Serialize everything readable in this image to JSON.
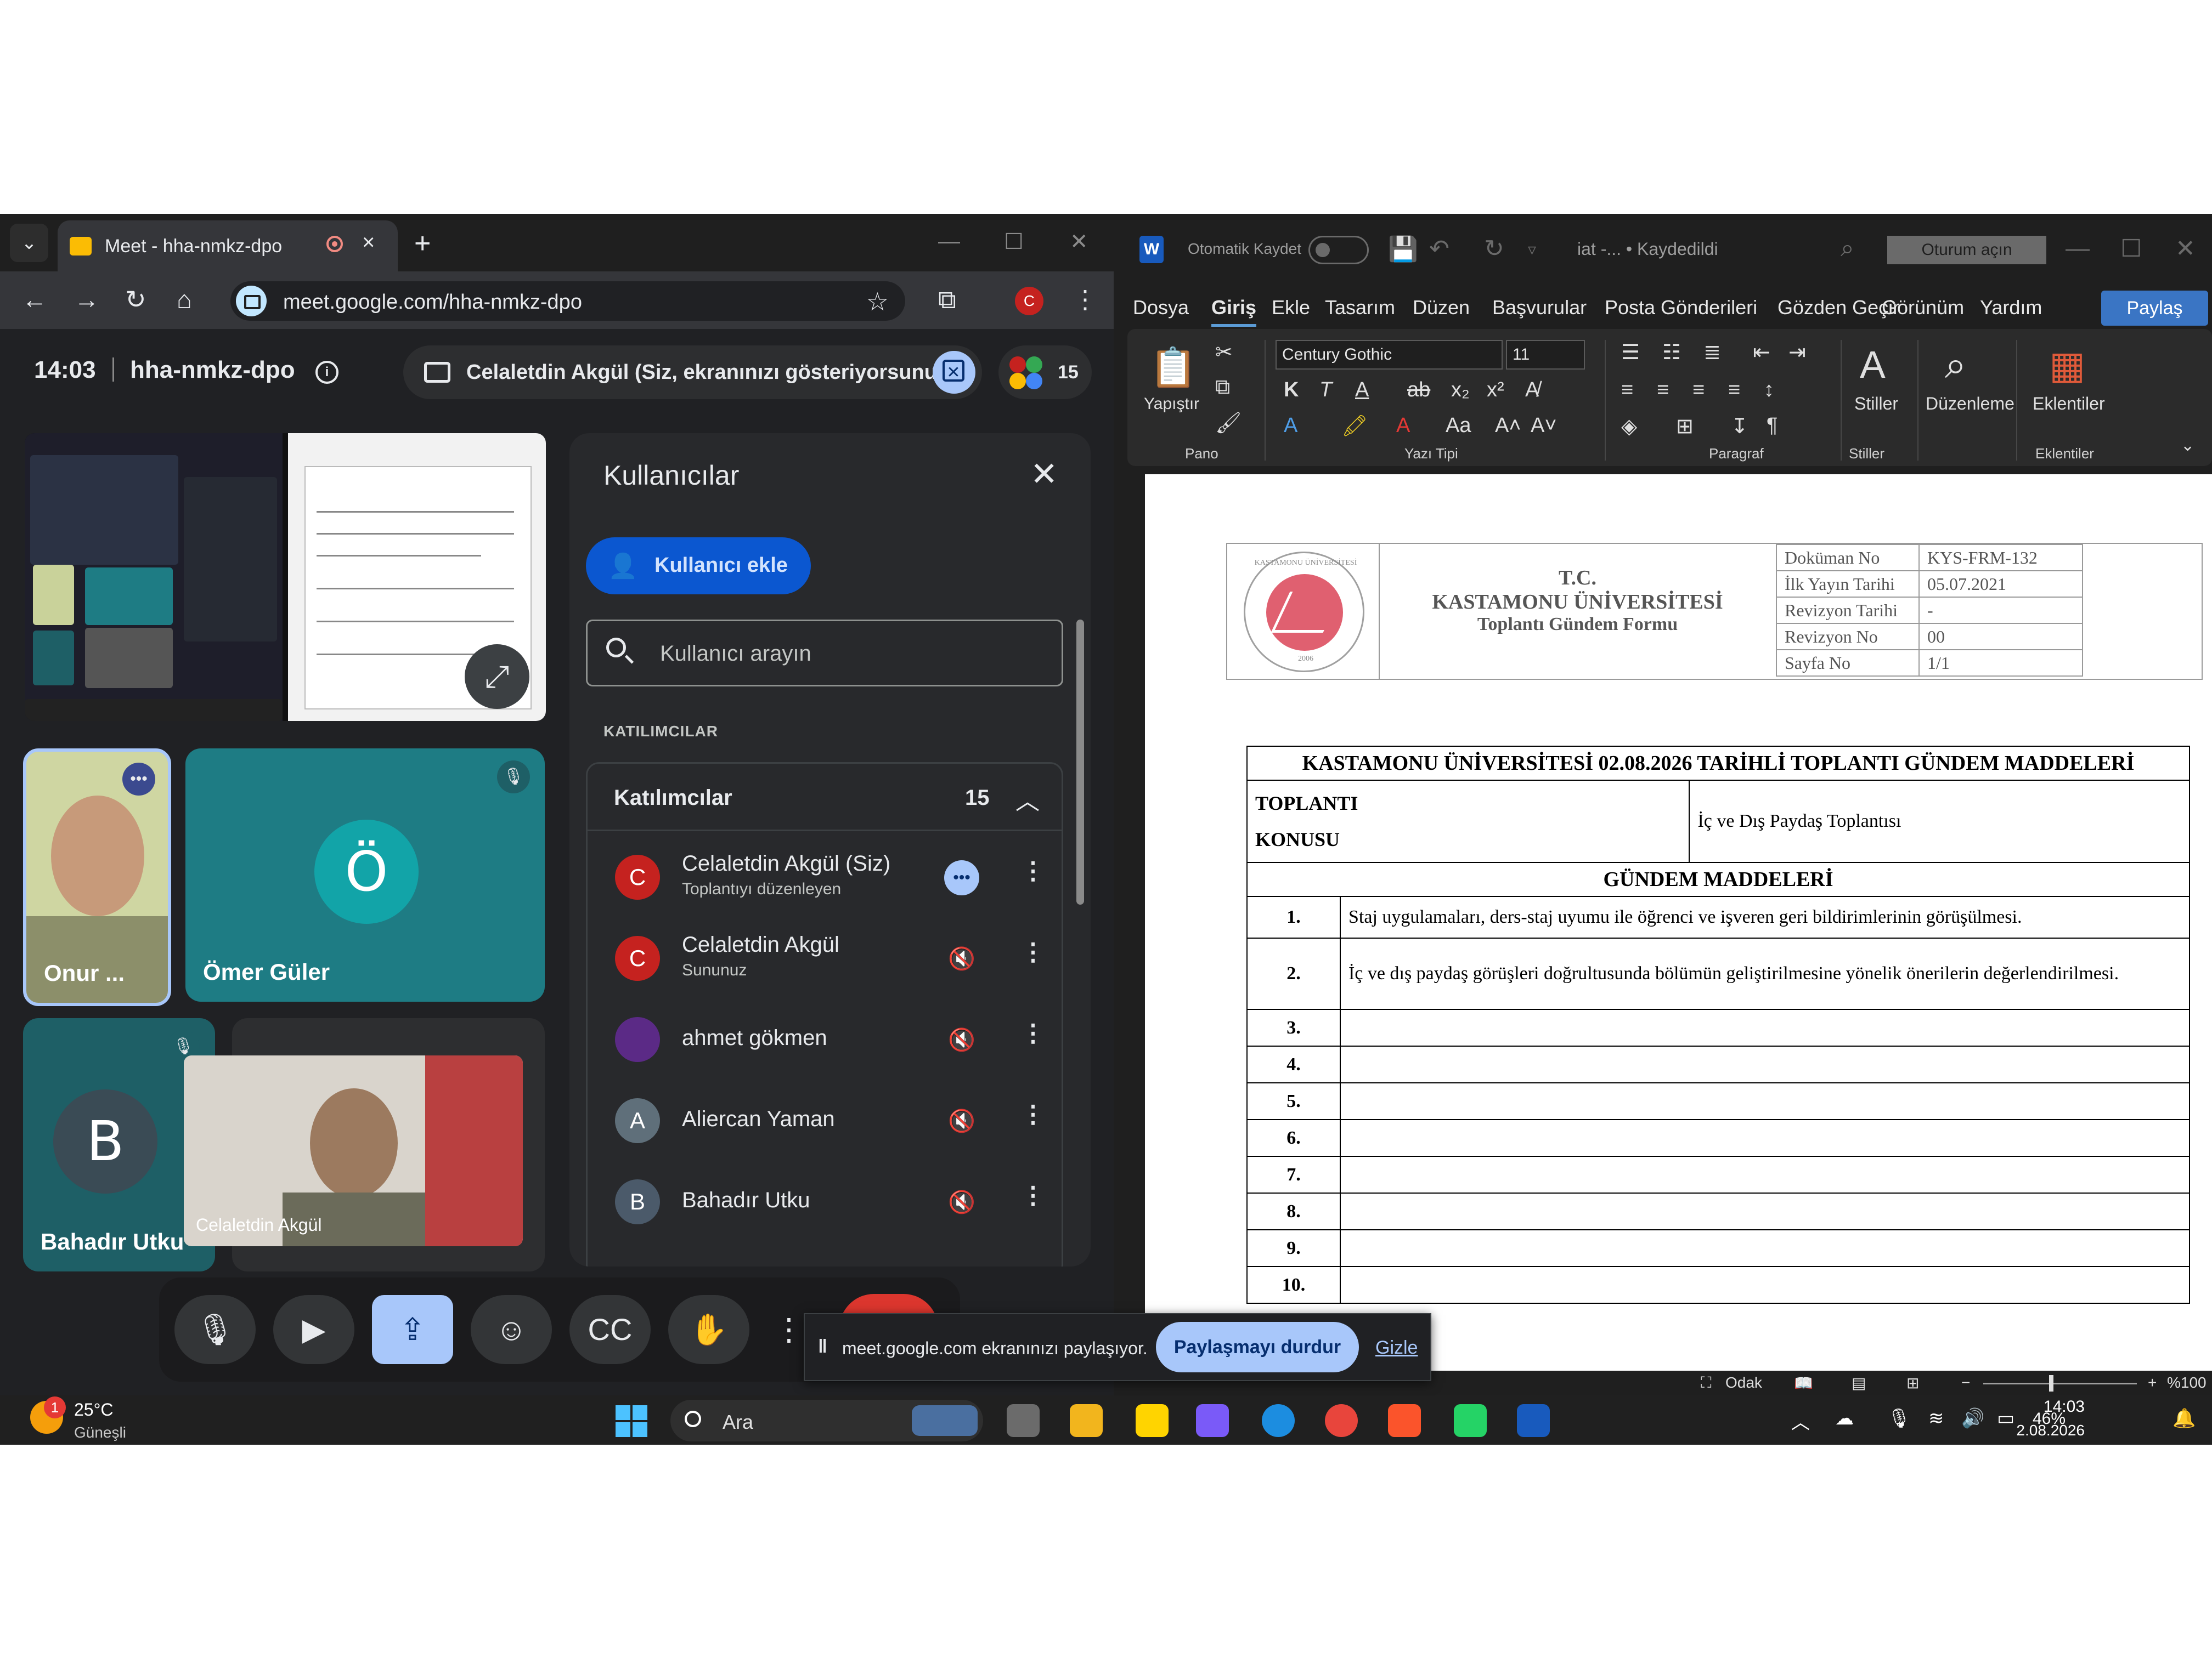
{
  "chrome": {
    "tab_title": "Meet - hha-nmkz-dpo",
    "new_tab": "+",
    "url": "meet.google.com/hha-nmkz-dpo",
    "profile_initial": "C"
  },
  "meet": {
    "time": "14:03",
    "code": "hha-nmkz-dpo",
    "presenting_text": "Celaletdin Akgül (Siz, ekranınızı gösteriyorsunuz)",
    "participant_count": "15",
    "tiles": [
      {
        "name": "Onur ...",
        "type": "video"
      },
      {
        "name": "Ömer Güler",
        "initial": "Ö",
        "color": "#1e7c84"
      },
      {
        "name": "Bahadır Utku",
        "initial": "B",
        "color": "#1e5f66"
      },
      {
        "name": "Celaletdin Akgül",
        "type": "video"
      }
    ]
  },
  "people_panel": {
    "title": "Kullanıcılar",
    "add_label": "Kullanıcı ekle",
    "search_placeholder": "Kullanıcı arayın",
    "section_label": "KATILIMCILAR",
    "list_header": "Katılımcılar",
    "list_count": "15",
    "participants": [
      {
        "name": "Celaletdin Akgül (Siz)",
        "sub": "Toplantıyı düzenleyen",
        "initial": "C",
        "color": "#c5221f",
        "state": "more"
      },
      {
        "name": "Celaletdin Akgül",
        "sub": "Sununuz",
        "initial": "C",
        "color": "#c5221f",
        "state": "muted"
      },
      {
        "name": "ahmet gökmen",
        "sub": "",
        "initial": "",
        "color": "#5b2a86",
        "state": "muted"
      },
      {
        "name": "Aliercan Yaman",
        "sub": "",
        "initial": "A",
        "color": "#5f6f7a",
        "state": "muted"
      },
      {
        "name": "Bahadır Utku",
        "sub": "",
        "initial": "B",
        "color": "#4b5a6a",
        "state": "muted"
      }
    ]
  },
  "share_notice": {
    "message": "meet.google.com ekranınızı paylaşıyor.",
    "stop_label": "Paylaşmayı durdur",
    "hide_label": "Gizle"
  },
  "word": {
    "autosave": "Otomatik Kaydet",
    "filename": "iat -...  • Kaydedildi",
    "signin": "Oturum açın",
    "tabs": [
      "Dosya",
      "Giriş",
      "Ekle",
      "Tasarım",
      "Düzen",
      "Başvurular",
      "Posta Gönderileri",
      "Gözden Geçir",
      "Görünüm",
      "Yardım"
    ],
    "share": "Paylaş",
    "font_name": "Century Gothic",
    "font_size": "11",
    "paste_label": "Yapıştır",
    "groups": {
      "clipboard": "Pano",
      "font": "Yazı Tipi",
      "paragraph": "Paragraf",
      "styles": "Stiller",
      "addins": "Eklentiler"
    },
    "styles_label": "Stiller",
    "editing_label": "Düzenleme",
    "addins_label": "Eklentiler",
    "status": {
      "focus": "Odak",
      "zoom": "%100"
    }
  },
  "document": {
    "seal_text": "KASTAMONU ÜNİVERSİTESİ",
    "seal_year": "2006",
    "header_l1": "T.C.",
    "header_l2": "KASTAMONU ÜNİVERSİTESİ",
    "header_l3": "Toplantı Gündem Formu",
    "meta": [
      {
        "k": "Doküman No",
        "v": "KYS-FRM-132"
      },
      {
        "k": "İlk Yayın Tarihi",
        "v": "05.07.2021"
      },
      {
        "k": "Revizyon Tarihi",
        "v": "-"
      },
      {
        "k": "Revizyon No",
        "v": "00"
      },
      {
        "k": "Sayfa No",
        "v": "1/1"
      }
    ],
    "main_title": "KASTAMONU ÜNİVERSİTESİ 02.08.2026 TARİHLİ TOPLANTI GÜNDEM MADDELERİ",
    "topic_label_1": "TOPLANTI",
    "topic_label_2": "KONUSU",
    "topic_value": "İç ve Dış Paydaş Toplantısı",
    "agenda_title": "GÜNDEM MADDELERİ",
    "items": [
      {
        "no": "1.",
        "text": "Staj uygulamaları, ders-staj uyumu ile öğrenci ve işveren geri bildirimlerinin görüşülmesi."
      },
      {
        "no": "2.",
        "text": "İç ve dış paydaş görüşleri doğrultusunda bölümün geliştirilmesine yönelik önerilerin değerlendirilmesi."
      },
      {
        "no": "3.",
        "text": ""
      },
      {
        "no": "4.",
        "text": ""
      },
      {
        "no": "5.",
        "text": ""
      },
      {
        "no": "6.",
        "text": ""
      },
      {
        "no": "7.",
        "text": ""
      },
      {
        "no": "8.",
        "text": ""
      },
      {
        "no": "9.",
        "text": ""
      },
      {
        "no": "10.",
        "text": ""
      }
    ]
  },
  "taskbar": {
    "notif_count": "1",
    "temperature": "25°C",
    "condition": "Güneşli",
    "search_placeholder": "Ara",
    "battery": "46%",
    "clock": "14:03",
    "date": "2.08.2026"
  }
}
